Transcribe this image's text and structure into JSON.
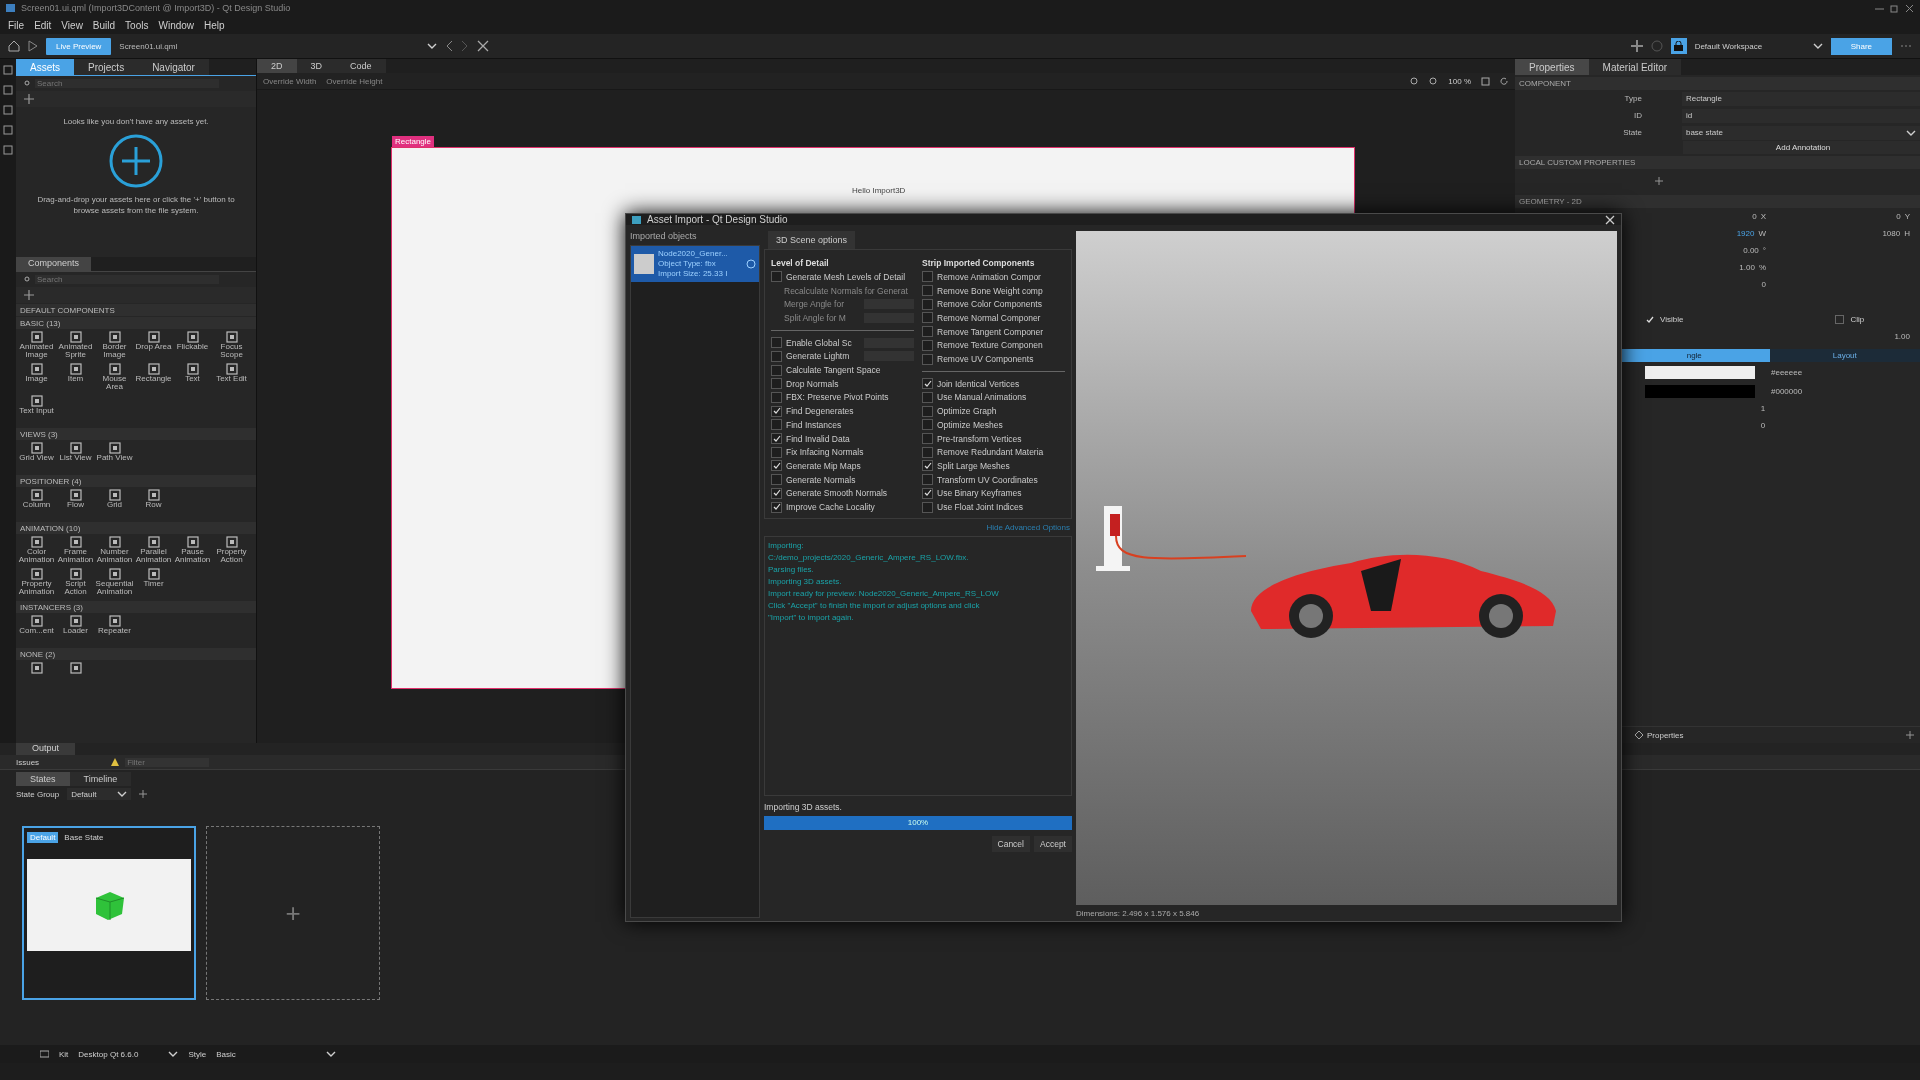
{
  "window": {
    "title": "Screen01.ui.qml (Import3DContent @ Import3D) - Qt Design Studio"
  },
  "menu": [
    "File",
    "Edit",
    "View",
    "Build",
    "Tools",
    "Window",
    "Help"
  ],
  "toolbar": {
    "live_preview": "Live Preview",
    "document": "Screen01.ui.qml",
    "workspace": "Default Workspace",
    "share": "Share"
  },
  "left_tabs": [
    {
      "label": "Assets",
      "selected": true
    },
    {
      "label": "Projects",
      "selected": false
    },
    {
      "label": "Navigator",
      "selected": false
    }
  ],
  "assets": {
    "search_placeholder": "Search",
    "empty_title": "Looks like you don't have any assets yet.",
    "empty_hint": "Drag-and-drop your assets here or click the '+' button to browse assets from the file system."
  },
  "components": {
    "tab": "Components",
    "search_placeholder": "Search",
    "header": "DEFAULT COMPONENTS",
    "sections": [
      {
        "title": "BASIC (13)",
        "items": [
          "Animated Image",
          "Animated Sprite",
          "Border Image",
          "Drop Area",
          "Flickable",
          "Focus Scope",
          "Image",
          "Item",
          "Mouse Area",
          "Rectangle",
          "Text",
          "Text Edit",
          "Text Input"
        ]
      },
      {
        "title": "VIEWS (3)",
        "items": [
          "Grid View",
          "List View",
          "Path View"
        ]
      },
      {
        "title": "POSITIONER (4)",
        "items": [
          "Column",
          "Flow",
          "Grid",
          "Row"
        ]
      },
      {
        "title": "ANIMATION (10)",
        "items": [
          "Color Animation",
          "Frame Animation",
          "Number Animation",
          "Parallel Animation",
          "Pause Animation",
          "Property Action",
          "Property Animation",
          "Script Action",
          "Sequential Animation",
          "Timer"
        ]
      },
      {
        "title": "INSTANCERS (3)",
        "items": [
          "Com...ent",
          "Loader",
          "Repeater"
        ]
      },
      {
        "title": "NONE (2)",
        "items": [
          {
            "kind": "icon"
          },
          {
            "kind": "icon"
          }
        ]
      }
    ]
  },
  "editor_tabs": [
    {
      "label": "2D",
      "selected": true
    },
    {
      "label": "3D",
      "selected": false
    },
    {
      "label": "Code",
      "selected": false
    }
  ],
  "editor_toolbar": {
    "override_width": "Override Width",
    "override_height": "Override Height",
    "zoom": "100 %"
  },
  "canvas": {
    "item_label": "Rectangle",
    "text": "Hello Import3D"
  },
  "properties": {
    "tabs": [
      {
        "label": "Properties",
        "selected": true
      },
      {
        "label": "Material Editor",
        "selected": false
      }
    ],
    "component_header": "COMPONENT",
    "fields": [
      {
        "label": "Type",
        "value": "Rectangle",
        "kind": "text"
      },
      {
        "label": "ID",
        "value": "id",
        "kind": "input"
      },
      {
        "label": "State",
        "value": "base state",
        "kind": "combo"
      }
    ],
    "add_annotation": "Add Annotation",
    "custom_header": "LOCAL CUSTOM PROPERTIES",
    "geometry_header": "GEOMETRY - 2D",
    "geometry_rows": [
      {
        "value": "0",
        "unit": "X",
        "value2": "0",
        "unit2": "Y"
      },
      {
        "value": "1920",
        "unit": "W",
        "value2": "1080",
        "unit2": "H"
      },
      {
        "value": "0.00",
        "unit": "°"
      },
      {
        "value": "1.00",
        "unit": "%"
      },
      {
        "value": "0"
      }
    ],
    "visible_label": "Visible",
    "visible": true,
    "clip_label": "Clip",
    "clip": false,
    "opacity": "1.00",
    "sub_tabs": [
      {
        "label": "ngle",
        "selected": true
      },
      {
        "label": "Layout",
        "selected": false
      }
    ],
    "colors": [
      {
        "color": "#eeeeee",
        "value": "#eeeeee"
      },
      {
        "color": "#000000",
        "value": "#000000"
      }
    ],
    "border_values": [
      "1",
      "0"
    ],
    "footer": "Properties"
  },
  "output_tab": "Output",
  "issues": {
    "label": "Issues",
    "filter_placeholder": "Filter"
  },
  "states_tabs": [
    {
      "label": "States",
      "selected": true
    },
    {
      "label": "Timeline",
      "selected": false
    }
  ],
  "state_group": {
    "label": "State Group",
    "value": "Default"
  },
  "states": [
    {
      "badge": "Default",
      "name": "Base State",
      "selected": true
    }
  ],
  "add_state": "+",
  "status_bar": {
    "kit_label": "Kit",
    "kit": "Desktop Qt 6.6.0",
    "style_label": "Style",
    "style": "Basic"
  },
  "dialog": {
    "title": "Asset Import - Qt Design Studio",
    "objects_label": "Imported objects",
    "objects": [
      {
        "name": "Node2020_Gener...",
        "type": "Object Type: fbx",
        "size": "Import Size: 25.33 I",
        "selected": true
      }
    ],
    "tab": "3D Scene options",
    "left_title": "Level of Detail",
    "left_groups": [
      [
        {
          "kind": "check",
          "label": "Generate Mesh Levels of Detail",
          "checked": false,
          "disabled": false
        },
        {
          "kind": "plain",
          "label": "Recalculate Normals for Generat",
          "disabled": true
        },
        {
          "kind": "spin",
          "label": "Merge Angle for",
          "disabled": true
        },
        {
          "kind": "spin",
          "label": "Split Angle for M",
          "disabled": true
        }
      ],
      [
        {
          "kind": "checkspin",
          "label": "Enable Global Sc",
          "checked": false,
          "disabled": false
        },
        {
          "kind": "checkspin",
          "label": "Generate Lightm",
          "checked": false,
          "disabled": false
        },
        {
          "kind": "check",
          "label": "Calculate Tangent Space",
          "checked": false,
          "disabled": false
        },
        {
          "kind": "check",
          "label": "Drop Normals",
          "checked": false,
          "disabled": false
        },
        {
          "kind": "check",
          "label": "FBX: Preserve Pivot Points",
          "checked": false,
          "disabled": false
        },
        {
          "kind": "check",
          "label": "Find Degenerates",
          "checked": true,
          "disabled": false
        },
        {
          "kind": "check",
          "label": "Find Instances",
          "checked": false,
          "disabled": false
        },
        {
          "kind": "check",
          "label": "Find Invalid Data",
          "checked": true,
          "disabled": false
        },
        {
          "kind": "check",
          "label": "Fix Infacing Normals",
          "checked": false,
          "disabled": false
        },
        {
          "kind": "check",
          "label": "Generate Mip Maps",
          "checked": true,
          "disabled": false
        },
        {
          "kind": "check",
          "label": "Generate Normals",
          "checked": false,
          "disabled": false
        },
        {
          "kind": "check",
          "label": "Generate Smooth Normals",
          "checked": true,
          "disabled": false
        },
        {
          "kind": "check",
          "label": "Improve Cache Locality",
          "checked": true,
          "disabled": false
        }
      ]
    ],
    "right_title": "Strip Imported Components",
    "right_groups": [
      [
        {
          "kind": "check",
          "label": "Remove Animation Compor",
          "checked": false,
          "disabled": false
        },
        {
          "kind": "check",
          "label": "Remove Bone Weight comp",
          "checked": false,
          "disabled": false
        },
        {
          "kind": "check",
          "label": "Remove Color Components",
          "checked": false,
          "disabled": false
        },
        {
          "kind": "check",
          "label": "Remove Normal Componer",
          "checked": false,
          "disabled": false
        },
        {
          "kind": "check",
          "label": "Remove Tangent Componer",
          "checked": false,
          "disabled": false
        },
        {
          "kind": "check",
          "label": "Remove Texture Componen",
          "checked": false,
          "disabled": false
        },
        {
          "kind": "check",
          "label": "Remove UV Components",
          "checked": false,
          "disabled": false
        }
      ],
      [
        {
          "kind": "check",
          "label": "Join Identical Vertices",
          "checked": true,
          "disabled": false
        },
        {
          "kind": "check",
          "label": "Use Manual Animations",
          "checked": false,
          "disabled": false
        },
        {
          "kind": "check",
          "label": "Optimize Graph",
          "checked": false,
          "disabled": false
        },
        {
          "kind": "check",
          "label": "Optimize Meshes",
          "checked": false,
          "disabled": false
        },
        {
          "kind": "check",
          "label": "Pre-transform Vertices",
          "checked": false,
          "disabled": false
        },
        {
          "kind": "check",
          "label": "Remove Redundant Materia",
          "checked": false,
          "disabled": false
        },
        {
          "kind": "check",
          "label": "Split Large Meshes",
          "checked": true,
          "disabled": false
        },
        {
          "kind": "check",
          "label": "Transform UV Coordinates",
          "checked": false,
          "disabled": false
        },
        {
          "kind": "check",
          "label": "Use Binary Keyframes",
          "checked": true,
          "disabled": false
        },
        {
          "kind": "check",
          "label": "Use Float Joint Indices",
          "checked": false,
          "disabled": false
        }
      ]
    ],
    "advanced_link": "Hide Advanced Options",
    "log": [
      "Importing:",
      "C:/demo_projects/2020_Generic_Ampere_RS_LOW.fbx.",
      "Parsing files.",
      "Importing 3D assets.",
      "Import ready for preview: Node2020_Generic_Ampere_RS_LOW",
      "Click \"Accept\" to finish the import or adjust options and click",
      "\"Import\" to import again."
    ],
    "status": "Importing 3D assets.",
    "progress": {
      "level": 1.0,
      "reading": "100%"
    },
    "buttons": [
      "Cancel",
      "Accept"
    ],
    "dimensions": "Dimensions: 2.496 x 1.576 x 5.846"
  }
}
